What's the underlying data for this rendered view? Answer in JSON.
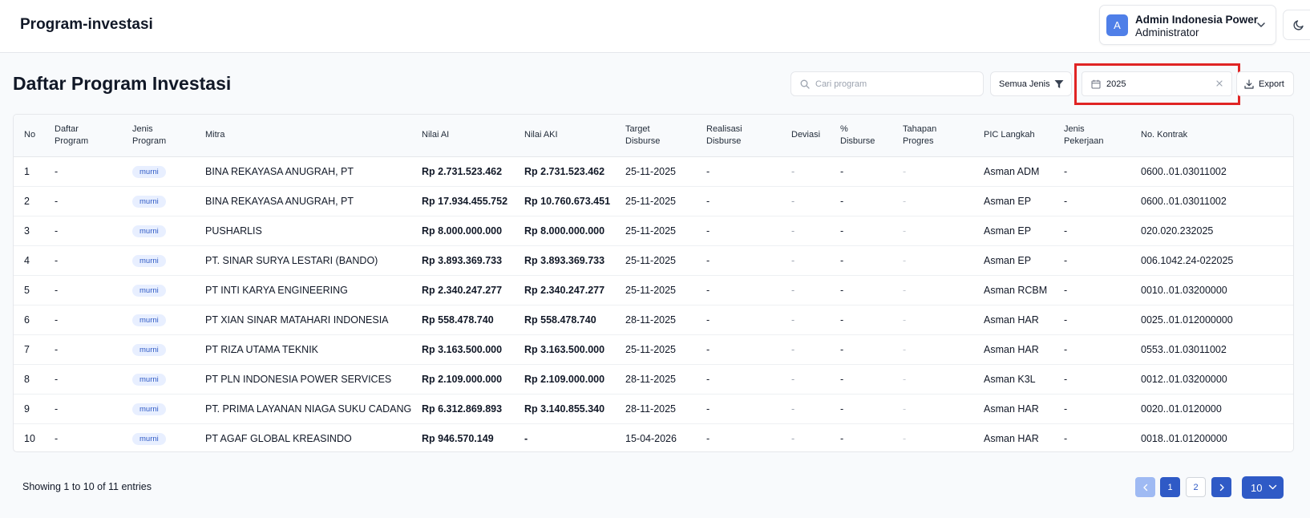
{
  "header": {
    "app_title": "Program-investasi",
    "user": {
      "initial": "A",
      "name": "Admin Indonesia Power",
      "role": "Administrator"
    }
  },
  "page": {
    "title": "Daftar Program Investasi"
  },
  "toolbar": {
    "search_placeholder": "Cari program",
    "search_value": "",
    "filter_label": "Semua Jenis",
    "date_value": "2025",
    "export_label": "Export"
  },
  "table": {
    "columns": [
      [
        "No"
      ],
      [
        "Daftar",
        "Program"
      ],
      [
        "Jenis",
        "Program"
      ],
      [
        "Mitra"
      ],
      [
        "Nilai AI"
      ],
      [
        "Nilai AKI"
      ],
      [
        "Target",
        "Disburse"
      ],
      [
        "Realisasi",
        "Disburse"
      ],
      [
        "Deviasi"
      ],
      [
        "%",
        "Disburse"
      ],
      [
        "Tahapan",
        "Progres"
      ],
      [
        "PIC Langkah"
      ],
      [
        "Jenis",
        "Pekerjaan"
      ],
      [
        "No. Kontrak"
      ]
    ],
    "rows": [
      [
        "1",
        "-",
        "murni",
        "BINA REKAYASA ANUGRAH, PT",
        "Rp 2.731.523.462",
        "Rp 2.731.523.462",
        "25-11-2025",
        "-",
        "-",
        "-",
        "-",
        "Asman ADM",
        "-",
        "0600..01.03011002"
      ],
      [
        "2",
        "-",
        "murni",
        "BINA REKAYASA ANUGRAH, PT",
        "Rp 17.934.455.752",
        "Rp 10.760.673.451",
        "25-11-2025",
        "-",
        "-",
        "-",
        "-",
        "Asman EP",
        "-",
        "0600..01.03011002"
      ],
      [
        "3",
        "-",
        "murni",
        "PUSHARLIS",
        "Rp 8.000.000.000",
        "Rp 8.000.000.000",
        "25-11-2025",
        "-",
        "-",
        "-",
        "-",
        "Asman EP",
        "-",
        "020.020.232025"
      ],
      [
        "4",
        "-",
        "murni",
        "PT. SINAR SURYA LESTARI (BANDO)",
        "Rp 3.893.369.733",
        "Rp 3.893.369.733",
        "25-11-2025",
        "-",
        "-",
        "-",
        "-",
        "Asman EP",
        "-",
        "006.1042.24-022025"
      ],
      [
        "5",
        "-",
        "murni",
        "PT INTI KARYA ENGINEERING",
        "Rp 2.340.247.277",
        "Rp 2.340.247.277",
        "25-11-2025",
        "-",
        "-",
        "-",
        "-",
        "Asman RCBM",
        "-",
        "0010..01.03200000"
      ],
      [
        "6",
        "-",
        "murni",
        "PT XIAN SINAR MATAHARI INDONESIA",
        "Rp 558.478.740",
        "Rp 558.478.740",
        "28-11-2025",
        "-",
        "-",
        "-",
        "-",
        "Asman HAR",
        "-",
        "0025..01.012000000"
      ],
      [
        "7",
        "-",
        "murni",
        "PT RIZA UTAMA TEKNIK",
        "Rp 3.163.500.000",
        "Rp 3.163.500.000",
        "25-11-2025",
        "-",
        "-",
        "-",
        "-",
        "Asman HAR",
        "-",
        "0553..01.03011002"
      ],
      [
        "8",
        "-",
        "murni",
        "PT PLN INDONESIA POWER SERVICES",
        "Rp 2.109.000.000",
        "Rp 2.109.000.000",
        "28-11-2025",
        "-",
        "-",
        "-",
        "-",
        "Asman K3L",
        "-",
        "0012..01.03200000"
      ],
      [
        "9",
        "-",
        "murni",
        "PT. PRIMA LAYANAN NIAGA SUKU CADANG",
        "Rp 6.312.869.893",
        "Rp 3.140.855.340",
        "28-11-2025",
        "-",
        "-",
        "-",
        "-",
        "Asman HAR",
        "-",
        "0020..01.0120000"
      ],
      [
        "10",
        "-",
        "murni",
        "PT AGAF GLOBAL KREASINDO",
        "Rp 946.570.149",
        "-",
        "15-04-2026",
        "-",
        "-",
        "-",
        "-",
        "Asman HAR",
        "-",
        "0018..01.01200000"
      ]
    ]
  },
  "footer": {
    "entries_text": "Showing 1 to 10 of 11 entries",
    "pages": [
      "1",
      "2"
    ],
    "page_size": "10"
  },
  "colors": {
    "accent": "#2f5ac6",
    "accent_light": "#9fbaf3",
    "avatar": "#4f7fe8",
    "highlight": "#e02424",
    "badge_bg": "#e8efff"
  }
}
